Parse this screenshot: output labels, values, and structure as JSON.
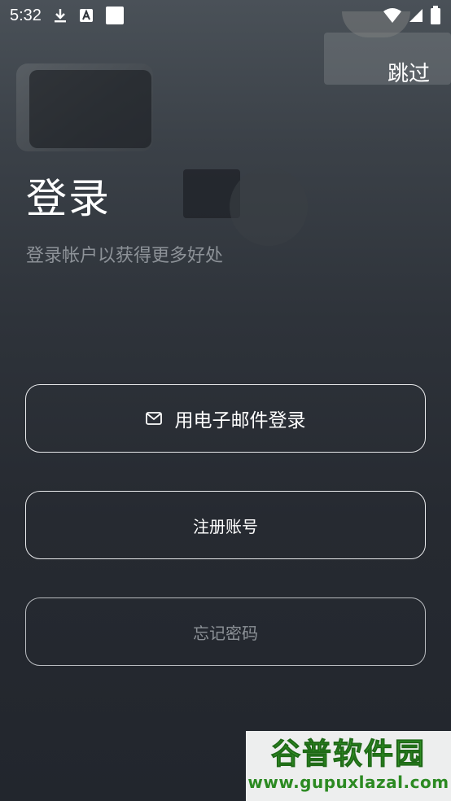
{
  "status_bar": {
    "time": "5:32",
    "icons_left": [
      "download-icon",
      "a-box-icon",
      "white-square-icon"
    ],
    "icons_right": [
      "wifi-icon",
      "signal-icon",
      "battery-icon"
    ]
  },
  "header": {
    "skip_label": "跳过"
  },
  "login": {
    "title": "登录",
    "subtitle": "登录帐户以获得更多好处"
  },
  "buttons": {
    "email_icon": "mail-icon",
    "email_label": "用电子邮件登录",
    "register_label": "注册账号",
    "forgot_label": "忘记密码"
  },
  "watermark": {
    "logo_text": "谷普软件园",
    "url": "www.gupuxlazal.com"
  },
  "colors": {
    "background_top": "#4a5158",
    "background_bottom": "#22262d",
    "subtitle": "#8d9298",
    "button_border": "#e9eaec",
    "forgot_text": "#8c9197",
    "watermark_green": "#3aa52b"
  }
}
